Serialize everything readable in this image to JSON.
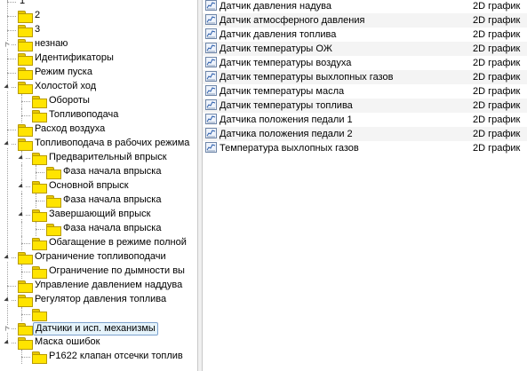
{
  "tree": {
    "items": [
      {
        "label": "1",
        "level": 0,
        "expander": "none",
        "folder": false
      },
      {
        "label": "2",
        "level": 0,
        "expander": "none",
        "folder": true
      },
      {
        "label": "3",
        "level": 0,
        "expander": "none",
        "folder": true
      },
      {
        "label": "незнаю",
        "level": 0,
        "expander": "closed",
        "folder": true
      },
      {
        "label": "Идентификаторы",
        "level": 0,
        "expander": "none",
        "folder": true
      },
      {
        "label": "Режим пуска",
        "level": 0,
        "expander": "none",
        "folder": true
      },
      {
        "label": "Холостой ход",
        "level": 0,
        "expander": "open",
        "folder": true
      },
      {
        "label": "Обороты",
        "level": 1,
        "expander": "none",
        "folder": true
      },
      {
        "label": "Топливоподача",
        "level": 1,
        "expander": "none",
        "folder": true
      },
      {
        "label": "Расход воздуха",
        "level": 0,
        "expander": "none",
        "folder": true
      },
      {
        "label": "Топливоподача в рабочих режима",
        "level": 0,
        "expander": "open",
        "folder": true
      },
      {
        "label": "Предварительный впрыск",
        "level": 1,
        "expander": "open",
        "folder": true
      },
      {
        "label": "Фаза начала впрыска",
        "level": 2,
        "expander": "none",
        "folder": true
      },
      {
        "label": "Основной впрыск",
        "level": 1,
        "expander": "open",
        "folder": true
      },
      {
        "label": "Фаза начала впрыска",
        "level": 2,
        "expander": "none",
        "folder": true
      },
      {
        "label": "Завершающий впрыск",
        "level": 1,
        "expander": "open",
        "folder": true
      },
      {
        "label": "Фаза начала впрыска",
        "level": 2,
        "expander": "none",
        "folder": true
      },
      {
        "label": "Обагащение в режиме полной",
        "level": 1,
        "expander": "none",
        "folder": true
      },
      {
        "label": "Ограничение топливоподачи",
        "level": 0,
        "expander": "open",
        "folder": true
      },
      {
        "label": "Ограничение по дымности вы",
        "level": 1,
        "expander": "none",
        "folder": true
      },
      {
        "label": "Управление давлением наддува",
        "level": 0,
        "expander": "none",
        "folder": true
      },
      {
        "label": "Регулятор давления топлива",
        "level": 0,
        "expander": "open",
        "folder": true
      },
      {
        "label": "",
        "level": 1,
        "expander": "none",
        "folder": true
      },
      {
        "label": "Датчики и исп. механизмы",
        "level": 0,
        "expander": "closed",
        "folder": true,
        "selected": true
      },
      {
        "label": "Маска ошибок",
        "level": 0,
        "expander": "open",
        "folder": true
      },
      {
        "label": "P1622 клапан отсечки топлив",
        "level": 1,
        "expander": "none",
        "folder": true
      }
    ]
  },
  "list": {
    "items": [
      {
        "name": "Датчик  давления надува",
        "type": "2D график"
      },
      {
        "name": "Датчик атмосферного давления",
        "type": "2D график"
      },
      {
        "name": "Датчик давления топлива",
        "type": "2D график"
      },
      {
        "name": "Датчик температуры ОЖ",
        "type": "2D график"
      },
      {
        "name": "Датчик температуры воздуха",
        "type": "2D график"
      },
      {
        "name": "Датчик температуры выхлопных газов",
        "type": "2D график"
      },
      {
        "name": "Датчик температуры масла",
        "type": "2D график"
      },
      {
        "name": "Датчик температуры топлива",
        "type": "2D график"
      },
      {
        "name": "Датчика положения педали 1",
        "type": "2D график"
      },
      {
        "name": "Датчика положения педали 2",
        "type": "2D график"
      },
      {
        "name": "Температура выхлопных газов",
        "type": "2D график"
      }
    ]
  },
  "icons": {
    "folder": "folder-icon",
    "chart": "chart-2d-icon"
  },
  "colors": {
    "folder": "#ffe400",
    "selection": "#e5f3fb",
    "selection_border": "#7da2ce"
  }
}
